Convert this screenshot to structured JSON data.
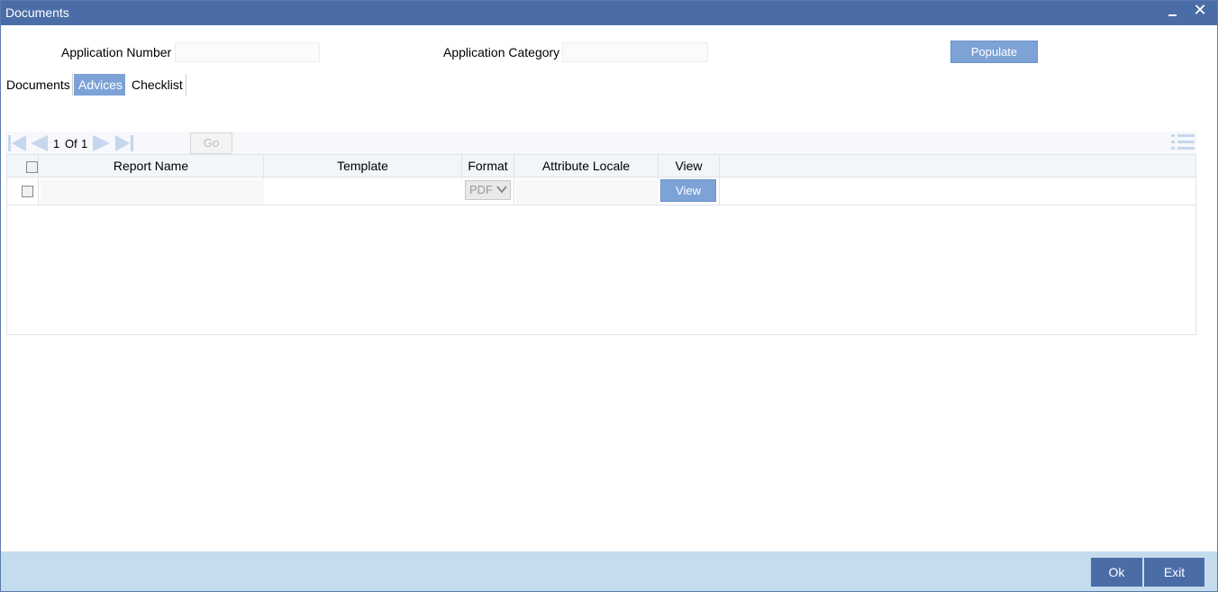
{
  "window": {
    "title": "Documents",
    "close_glyph": "✕"
  },
  "header": {
    "application_number_label": "Application Number",
    "application_number_value": "",
    "application_category_label": "Application Category",
    "application_category_value": "",
    "populate_label": "Populate"
  },
  "tabs": [
    {
      "label": "Documents",
      "active": false
    },
    {
      "label": "Advices",
      "active": true
    },
    {
      "label": "Checklist",
      "active": false
    }
  ],
  "pager": {
    "current": "1",
    "of_label": "Of",
    "total": "1",
    "go_label": "Go",
    "page_input": ""
  },
  "table": {
    "columns": [
      "Report Name",
      "Template",
      "Format",
      "Attribute Locale",
      "View"
    ],
    "rows": [
      {
        "report_name": "",
        "template": "",
        "format": "PDF",
        "attribute_locale": "",
        "view_label": "View"
      }
    ]
  },
  "footer": {
    "ok_label": "Ok",
    "exit_label": "Exit"
  },
  "icons": {
    "first": "first-page-icon",
    "prev": "previous-page-icon",
    "next": "next-page-icon",
    "last": "last-page-icon",
    "menu": "list-menu-icon",
    "minimize": "minimize-icon",
    "close": "close-icon"
  },
  "colors": {
    "titlebar": "#4a6da7",
    "accent": "#7da2d6",
    "footer": "#c5dcee"
  }
}
